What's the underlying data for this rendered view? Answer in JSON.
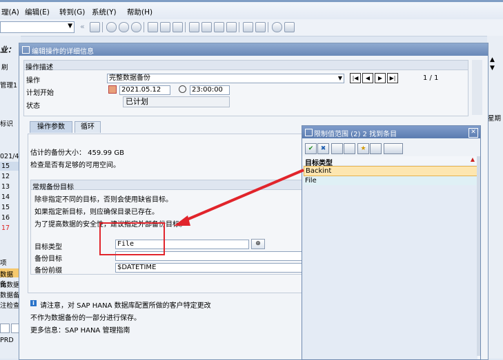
{
  "menu": {
    "items": [
      "理(A)",
      "编辑(E)",
      "转到(G)",
      "系统(Y)",
      "帮助(H)"
    ]
  },
  "toolbar": {
    "command_field": "",
    "icons": [
      "enter-icon",
      "save-icon",
      "back-icon",
      "exit-icon",
      "cancel-icon",
      "print-icon",
      "find-icon",
      "find-next-icon",
      "first-page-icon",
      "prev-page-icon",
      "next-page-icon",
      "last-page-icon",
      "new-session-icon",
      "shortcut-icon",
      "help-icon",
      "layout-icon"
    ]
  },
  "background": {
    "title_fragment": "业：",
    "refresh_fragment": "刷",
    "mgmt_fragment": "管理1",
    "id_fragment": "标识",
    "date_fragment": "021/4",
    "days": [
      "15",
      "12",
      "13",
      "14",
      "15",
      "16",
      "17"
    ],
    "list_fragments": [
      "项",
      "数据备",
      "比数据",
      "数据备",
      "注检查"
    ],
    "prd": "PRD",
    "right_fragment": "星期"
  },
  "dialog": {
    "title": "编辑操作的详细信息",
    "section_title": "操作描述",
    "operation_label": "操作",
    "operation_value": "完整数据备份",
    "page_counter": "1 / 1",
    "plan_start_label": "计划开始",
    "date_value": "2021.05.12",
    "time_value": "23:00:00",
    "status_label": "状态",
    "status_value": "已计划",
    "tabs": [
      "操作参数",
      "循环"
    ],
    "estimated_size": "估计的备份大小： 459.99 GB",
    "check_space": "检查是否有足够的可用空间。",
    "target_section_title": "常规备份目标",
    "info_lines": [
      "除非指定不同的目标，否则会使用缺省目标。",
      "如果指定新目标，则应确保目录已存在。",
      "为了提高数据的安全性，建议指定外部备份目标。"
    ],
    "target_type_label": "目标类型",
    "target_type_value": "File",
    "backup_target_label": "备份目标",
    "backup_target_value": "",
    "backup_prefix_label": "备份前缀",
    "backup_prefix_value": "$DATETIME",
    "note_line1": "请注意，对 SAP HANA 数据库配置所做的客户特定更改",
    "note_line2": "不作为数据备份的一部分进行保存。",
    "note_line3": "更多信息：SAP HANA 管理指南"
  },
  "popup": {
    "title": "限制值范围 (2)   2 找到条目",
    "column_header": "目标类型",
    "rows": [
      "Backint",
      "File"
    ]
  },
  "colors": {
    "annotation_red": "#e1242b",
    "selected_row": "#fde6b0",
    "header_blue": "#6a89b8"
  }
}
